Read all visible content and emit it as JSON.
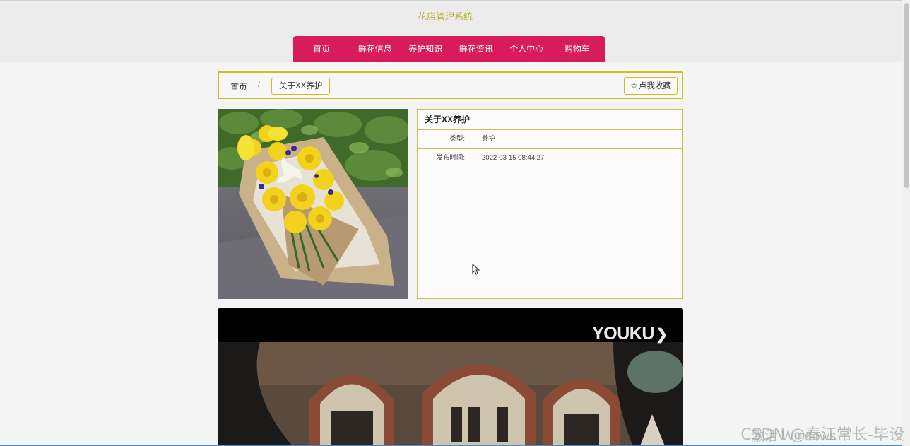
{
  "site": {
    "title": "花店管理系统"
  },
  "nav": {
    "items": [
      "首页",
      "鲜花信息",
      "养护知识",
      "鲜花资讯",
      "个人中心",
      "购物车"
    ]
  },
  "breadcrumb": {
    "home": "首页",
    "separator": "/",
    "current": "关于XX养护"
  },
  "favorite": {
    "icon": "star-outline-icon",
    "label": "点我收藏"
  },
  "article": {
    "title": "关于XX养护",
    "type_label": "类型:",
    "type_value": "养护",
    "time_label": "发布时间:",
    "time_value": "2022-03-15 08:44:27"
  },
  "video": {
    "logo": "YOUKU"
  },
  "overlay": {
    "watermark": "CSDN @春江常长-毕设",
    "activate": "激活 Windows"
  },
  "colors": {
    "accent": "#d81b5c",
    "border": "#c8c020",
    "title": "#b8b030"
  }
}
